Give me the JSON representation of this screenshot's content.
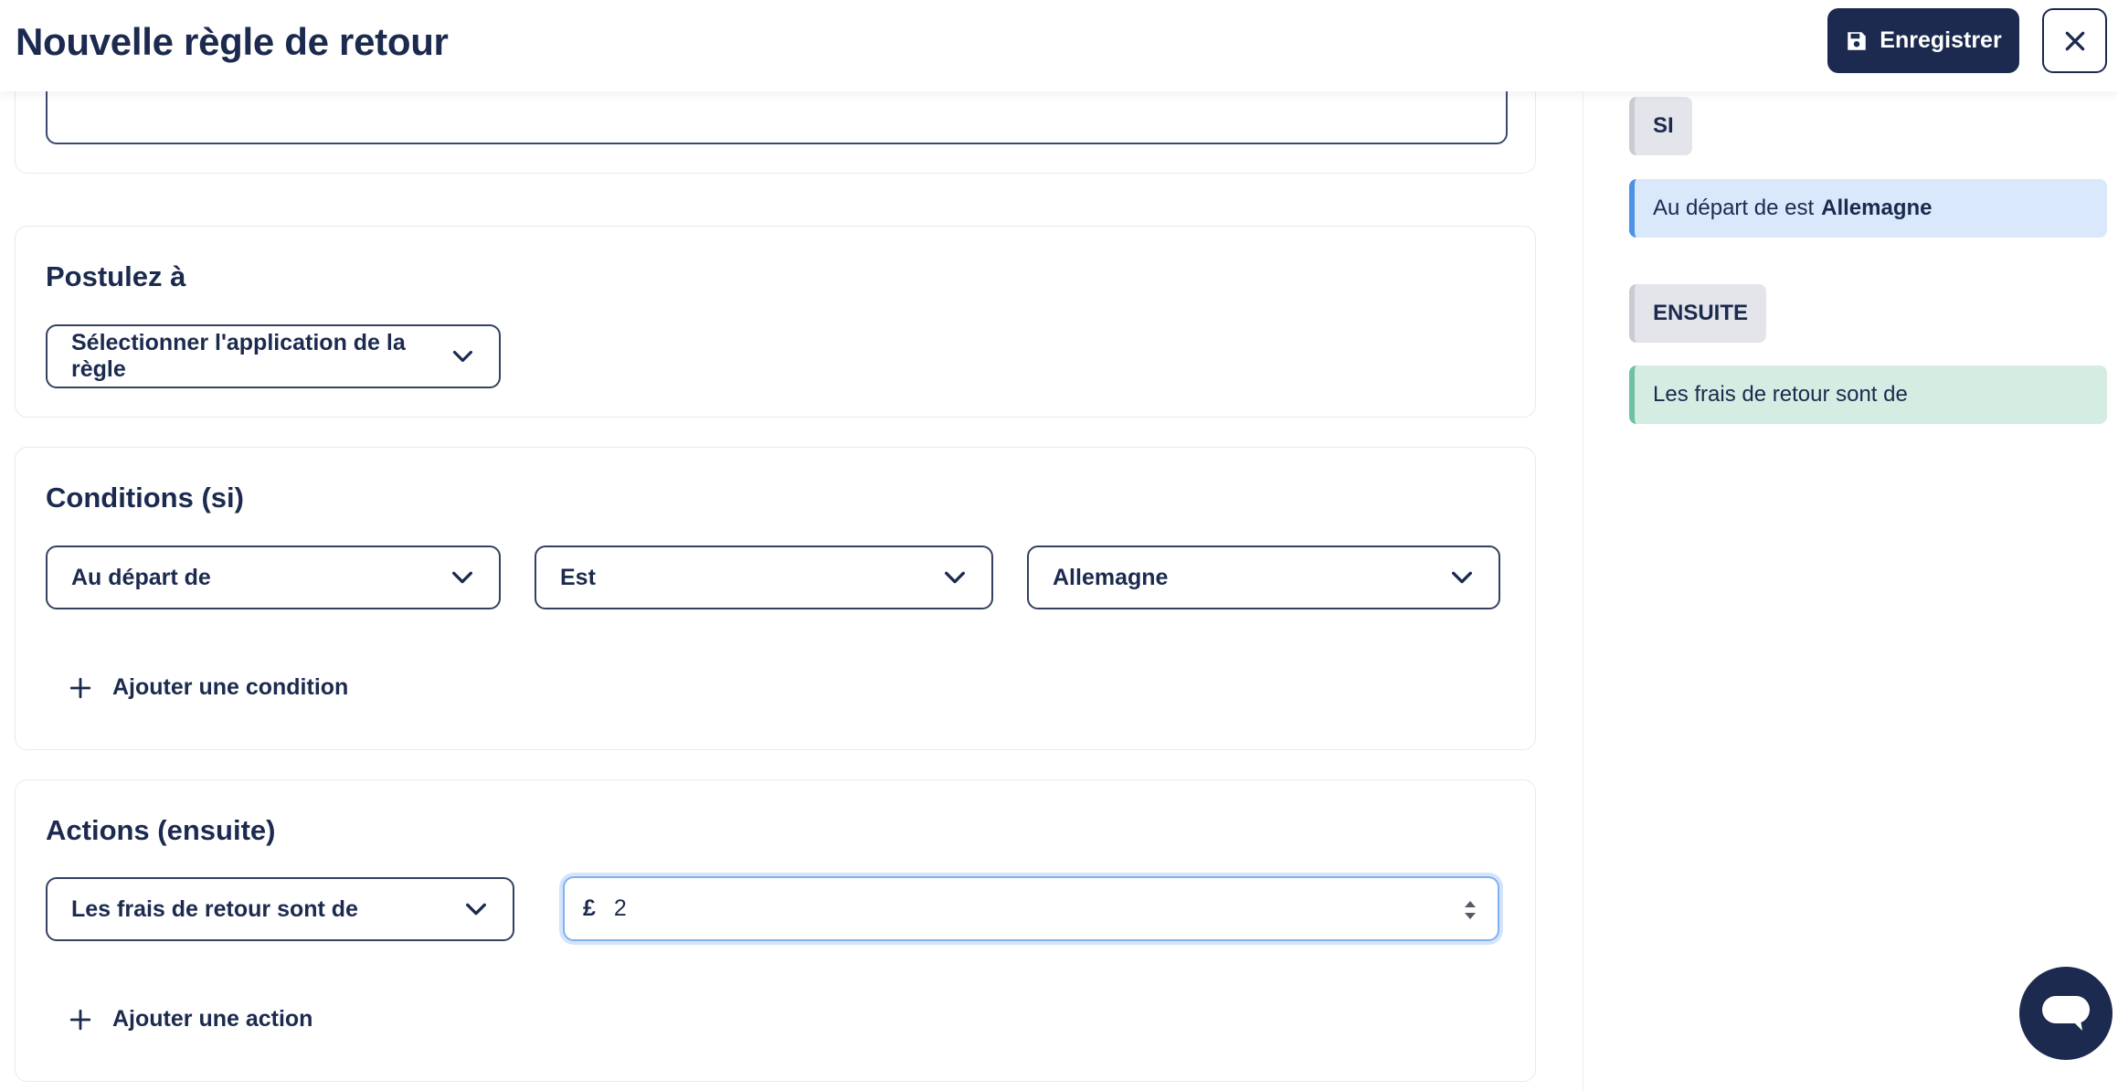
{
  "header": {
    "title": "Nouvelle règle de retour",
    "save_label": "Enregistrer",
    "save_icon": "floppy-disk-icon",
    "close_icon": "close-icon"
  },
  "apply_to": {
    "title": "Postulez à",
    "select_value": "Sélectionner l'application de la règle"
  },
  "conditions": {
    "title": "Conditions (si)",
    "field": "Au départ de",
    "operator": "Est",
    "value": "Allemagne",
    "add_label": "Ajouter une condition"
  },
  "actions": {
    "title": "Actions (ensuite)",
    "action": "Les frais de retour sont de",
    "currency": "£",
    "amount": "2",
    "add_label": "Ajouter une action"
  },
  "summary": {
    "if_badge": "SI",
    "if_text": "Au départ de est",
    "if_value": "Allemagne",
    "then_badge": "ENSUITE",
    "then_text": "Les frais de retour sont de"
  },
  "colors": {
    "primary": "#1b2a4e",
    "if_accent": "#4d92e6",
    "then_accent": "#6fc2a1",
    "focus_ring": "#7fb0ef"
  }
}
